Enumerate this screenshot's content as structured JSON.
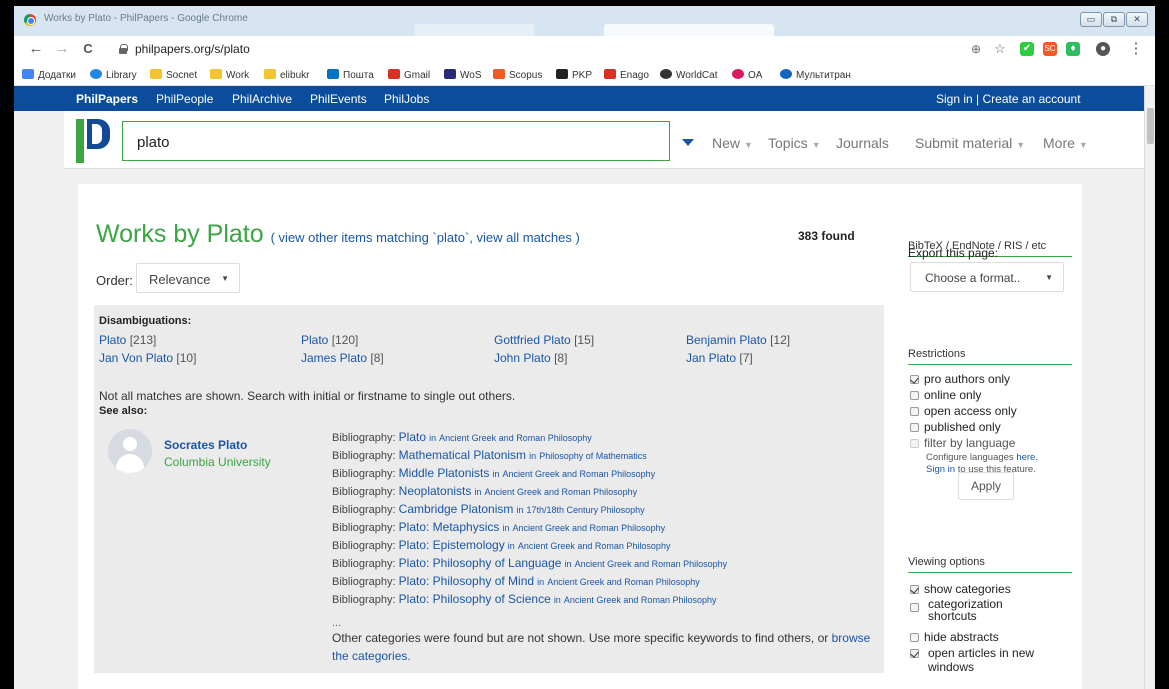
{
  "window": {
    "title": "Works by Plato - PhilPapers - Google Chrome",
    "minimize": "▭",
    "maximize": "⧉",
    "close": "✕"
  },
  "browser": {
    "back": "←",
    "forward": "→",
    "reload": "C",
    "url": "philpapers.org/s/plato",
    "zoom_icon": "⊕",
    "star_icon": "☆",
    "menu_icon": "⋮",
    "extensions": [
      {
        "name": "check-extension",
        "color": "#2ecc40",
        "glyph": "✔"
      },
      {
        "name": "sc-extension",
        "color": "#f15a24",
        "glyph": "SC"
      },
      {
        "name": "evernote-extension",
        "color": "#2dbe60",
        "glyph": "♦"
      },
      {
        "name": "avatar-extension",
        "color": "#555555",
        "glyph": "●"
      }
    ]
  },
  "bookmarks": [
    {
      "label": "Додатки",
      "color": "#4285f4"
    },
    {
      "label": "Library",
      "color": "#1e88e5"
    },
    {
      "label": "Socnet",
      "color": "#f4c430"
    },
    {
      "label": "Work",
      "color": "#f4c430"
    },
    {
      "label": "elibukr",
      "color": "#f4c430"
    },
    {
      "label": "Пошта",
      "color": "#0072c6"
    },
    {
      "label": "Gmail",
      "color": "#d93025"
    },
    {
      "label": "WoS",
      "color": "#2a2a7a"
    },
    {
      "label": "Scopus",
      "color": "#f15a24"
    },
    {
      "label": "PKP",
      "color": "#222222"
    },
    {
      "label": "Enago",
      "color": "#d93025"
    },
    {
      "label": "WorldCat",
      "color": "#333333"
    },
    {
      "label": "OA",
      "color": "#d81b60"
    },
    {
      "label": "Мультитран",
      "color": "#1565c0"
    }
  ],
  "topnav": {
    "items": [
      "PhilPapers",
      "PhilPeople",
      "PhilArchive",
      "PhilEvents",
      "PhilJobs"
    ],
    "signin": "Sign in | Create an account"
  },
  "header": {
    "search_value": "plato",
    "menu": [
      "New",
      "Topics",
      "Journals",
      "Submit material",
      "More"
    ]
  },
  "main": {
    "title": "Works by Plato",
    "view_other": "( view other items matching `plato`, view all matches )",
    "found": "383 found",
    "order_label": "Order:",
    "order_value": "Relevance",
    "disambiguations_heading": "Disambiguations:",
    "disambiguations": [
      {
        "name": "Plato",
        "count": "[213]"
      },
      {
        "name": "Plato",
        "count": "[120]"
      },
      {
        "name": "Gottfried Plato",
        "count": "[15]"
      },
      {
        "name": "Benjamin Plato",
        "count": "[12]"
      },
      {
        "name": "Jan Von Plato",
        "count": "[10]"
      },
      {
        "name": "James Plato",
        "count": "[8]"
      },
      {
        "name": "John Plato",
        "count": "[8]"
      },
      {
        "name": "Jan Plato",
        "count": "[7]"
      }
    ],
    "not_all": "Not all matches are shown. Search with initial or firstname to single out others.",
    "see_also": "See also:",
    "person_name": "Socrates Plato",
    "person_affiliation": "Columbia University",
    "bibliographies": [
      {
        "prefix": "Bibliography:",
        "link": "Plato",
        "in": "in",
        "area": "Ancient Greek and Roman Philosophy"
      },
      {
        "prefix": "Bibliography:",
        "link": "Mathematical Platonism",
        "in": "in",
        "area": "Philosophy of Mathematics"
      },
      {
        "prefix": "Bibliography:",
        "link": "Middle Platonists",
        "in": "in",
        "area": "Ancient Greek and Roman Philosophy"
      },
      {
        "prefix": "Bibliography:",
        "link": "Neoplatonists",
        "in": "in",
        "area": "Ancient Greek and Roman Philosophy"
      },
      {
        "prefix": "Bibliography:",
        "link": "Cambridge Platonism",
        "in": "in",
        "area": "17th/18th Century Philosophy"
      },
      {
        "prefix": "Bibliography:",
        "link": "Plato: Metaphysics",
        "in": "in",
        "area": "Ancient Greek and Roman Philosophy"
      },
      {
        "prefix": "Bibliography:",
        "link": "Plato: Epistemology",
        "in": "in",
        "area": "Ancient Greek and Roman Philosophy"
      },
      {
        "prefix": "Bibliography:",
        "link": "Plato: Philosophy of Language",
        "in": "in",
        "area": "Ancient Greek and Roman Philosophy"
      },
      {
        "prefix": "Bibliography:",
        "link": "Plato: Philosophy of Mind",
        "in": "in",
        "area": "Ancient Greek and Roman Philosophy"
      },
      {
        "prefix": "Bibliography:",
        "link": "Plato: Philosophy of Science",
        "in": "in",
        "area": "Ancient Greek and Roman Philosophy"
      }
    ],
    "ellipsis": "...",
    "other_text": "Other categories were found but are not shown. Use more specific keywords to find others, or",
    "other_link": "browse the categories."
  },
  "sidebar": {
    "export_heading": "BibTeX / EndNote / RIS / etc",
    "export_label": "Export this page:",
    "format_placeholder": "Choose a format..",
    "restrictions_heading": "Restrictions",
    "restrictions": [
      {
        "label": "pro authors only",
        "checked": true
      },
      {
        "label": "online only",
        "checked": false
      },
      {
        "label": "open access only",
        "checked": false
      },
      {
        "label": "published only",
        "checked": false
      },
      {
        "label": "filter by language",
        "checked": false
      }
    ],
    "configure_text": "Configure languages",
    "configure_link": "here.",
    "signin_link": "Sign in",
    "signin_text": "to use this feature.",
    "apply": "Apply",
    "viewing_heading": "Viewing options",
    "viewing": [
      {
        "label": "show categories",
        "checked": true
      },
      {
        "label": "categorization shortcuts",
        "checked": false
      },
      {
        "label": "hide abstracts",
        "checked": false
      },
      {
        "label": "open articles in new windows",
        "checked": true
      }
    ]
  }
}
